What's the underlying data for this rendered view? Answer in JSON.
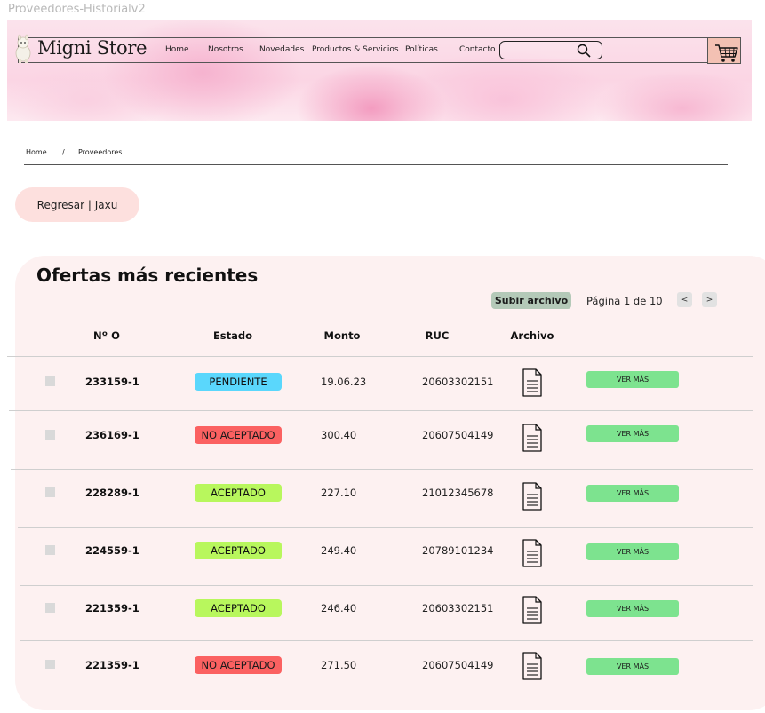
{
  "frame_title": "Proveedores-Historialv2",
  "brand": "Migni Store",
  "nav": [
    "Home",
    "Nosotros",
    "Novedades",
    "Productos & Servicios",
    "Políticas",
    "Contacto"
  ],
  "search": {
    "placeholder": ""
  },
  "breadcrumb": {
    "home": "Home",
    "sep": "/",
    "current": "Proveedores"
  },
  "back_button": "Regresar | Jaxu",
  "panel": {
    "title": "Ofertas más recientes",
    "upload_button": "Subir archivo",
    "pagination": {
      "label": "Página 1 de 10",
      "prev": "<",
      "next": ">"
    },
    "columns": [
      "Nº O",
      "Estado",
      "Monto",
      "RUC",
      "Archivo"
    ],
    "rows": [
      {
        "number": "233159-1",
        "status": "PENDIENTE",
        "status_type": "pending",
        "amount": "19.06.23",
        "ruc": "20603302151",
        "action": "VER MÁS"
      },
      {
        "number": "236169-1",
        "status": "NO ACEPTADO",
        "status_type": "rejected",
        "amount": "300.40",
        "ruc": "20607504149",
        "action": "VER MÁS"
      },
      {
        "number": "228289-1",
        "status": "ACEPTADO",
        "status_type": "accepted",
        "amount": "227.10",
        "ruc": "21012345678",
        "action": "VER MÁS"
      },
      {
        "number": "224559-1",
        "status": "ACEPTADO",
        "status_type": "accepted",
        "amount": "249.40",
        "ruc": "20789101234",
        "action": "VER MÁS"
      },
      {
        "number": "221359-1",
        "status": "ACEPTADO",
        "status_type": "accepted",
        "amount": "246.40",
        "ruc": "20603302151",
        "action": "VER MÁS"
      },
      {
        "number": "221359-1",
        "status": "NO ACEPTADO",
        "status_type": "rejected",
        "amount": "271.50",
        "ruc": "20607504149",
        "action": "VER MÁS"
      }
    ]
  },
  "colors": {
    "pending": "#5ad7fc",
    "rejected": "#fb6161",
    "accepted": "#b8f75d",
    "action": "#7de38f",
    "panel": "#fdf1f1",
    "cart": "#f3c1b3"
  },
  "icons": {
    "logo": "llama-icon",
    "search": "search-icon",
    "cart": "cart-icon",
    "file": "document-icon"
  }
}
